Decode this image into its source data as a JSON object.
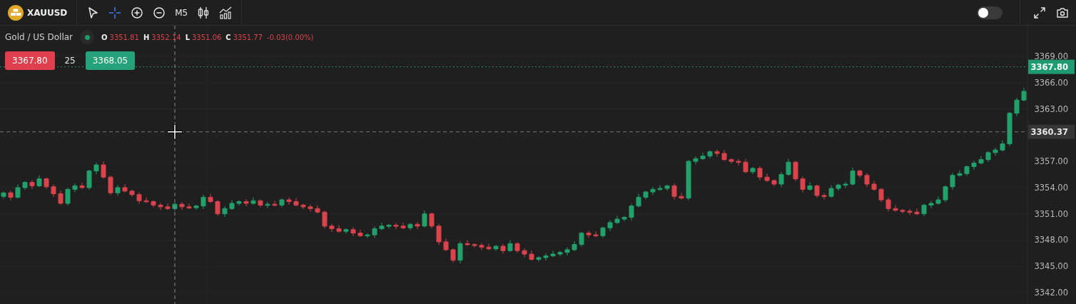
{
  "toolbar": {
    "symbol": "XAUUSD",
    "timeframe": "M5",
    "crosshair_selected": true,
    "toggle_on": false
  },
  "legend": {
    "name": "Gold / US Dollar",
    "live": true,
    "ohlc": [
      {
        "label": "O",
        "value": "3351.81"
      },
      {
        "label": "H",
        "value": "3352.14"
      },
      {
        "label": "L",
        "value": "3351.06"
      },
      {
        "label": "C",
        "value": "3351.77"
      }
    ],
    "change": "-0.03(0.00%)"
  },
  "quote": {
    "sell": "3367.80",
    "spread": "25",
    "buy": "3368.05"
  },
  "chart": {
    "price_axis": [
      "3369.00",
      "3366.00",
      "3363.00",
      "3357.00",
      "3354.00",
      "3351.00",
      "3348.00",
      "3345.00",
      "3342.00"
    ],
    "price_labels": [
      {
        "kind": "bid",
        "text": "3367.80"
      },
      {
        "kind": "crosshair",
        "text": "3360.37"
      }
    ]
  }
}
